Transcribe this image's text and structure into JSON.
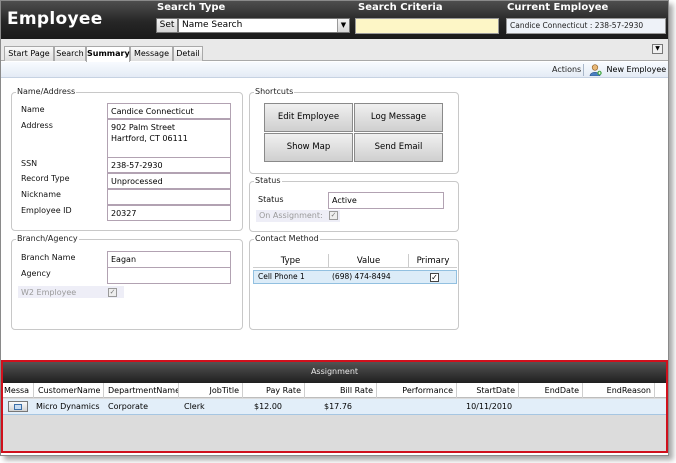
{
  "header": {
    "app_title": "Employee",
    "search_type_label": "Search Type",
    "set_button": "Set",
    "search_type_value": "Name Search",
    "search_criteria_label": "Search Criteria",
    "search_criteria_value": "",
    "current_employee_label": "Current Employee",
    "current_employee_value": "Candice  Connecticut : 238-57-2930"
  },
  "tabs": [
    {
      "label": "Start Page"
    },
    {
      "label": "Search"
    },
    {
      "label": "Summary",
      "active": true
    },
    {
      "label": "Message"
    },
    {
      "label": "Detail"
    }
  ],
  "actionbar": {
    "actions_label": "Actions",
    "new_employee_label": "New Employee"
  },
  "name_address": {
    "title": "Name/Address",
    "name_label": "Name",
    "name_value": "Candice  Connecticut",
    "address_label": "Address",
    "address_line1": "902 Palm Street",
    "address_line2": "Hartford, CT 06111",
    "ssn_label": "SSN",
    "ssn_value": "238-57-2930",
    "record_type_label": "Record Type",
    "record_type_value": "Unprocessed",
    "nickname_label": "Nickname",
    "nickname_value": "",
    "employee_id_label": "Employee ID",
    "employee_id_value": "20327"
  },
  "branch": {
    "title": "Branch/Agency",
    "branch_name_label": "Branch Name",
    "branch_name_value": "Eagan",
    "agency_label": "Agency",
    "agency_value": "",
    "w2_label": "W2 Employee",
    "w2_checked": true
  },
  "shortcuts": {
    "title": "Shortcuts",
    "edit_employee": "Edit Employee",
    "log_message": "Log Message",
    "show_map": "Show Map",
    "send_email": "Send Email"
  },
  "status": {
    "title": "Status",
    "status_label": "Status",
    "status_value": "Active",
    "on_assignment_label": "On Assignment:",
    "on_assignment_checked": true
  },
  "contact_method": {
    "title": "Contact Method",
    "headers": {
      "type": "Type",
      "value": "Value",
      "primary": "Primary"
    },
    "rows": [
      {
        "type": "Cell Phone 1",
        "value": "(698) 474-8494",
        "primary": true
      }
    ]
  },
  "assignment": {
    "title": "Assignment",
    "columns": {
      "message": "Messa",
      "customer": "CustomerName",
      "department": "DepartmentName",
      "job": "JobTitle",
      "pay": "Pay Rate",
      "bill": "Bill Rate",
      "performance": "Performance",
      "start": "StartDate",
      "end": "EndDate",
      "end_reason": "EndReason"
    },
    "rows": [
      {
        "customer": "Micro Dynamics",
        "department": "Corporate",
        "job": "Clerk",
        "pay": "$12.00",
        "bill": "$17.76",
        "performance": "",
        "start": "10/11/2010",
        "end": "",
        "end_reason": ""
      }
    ]
  },
  "colors": {
    "header_bg": "#262626",
    "criteria_bg": "#fdf6c6",
    "assignment_border": "#d0101c",
    "selected_row": "#e2eef9"
  }
}
